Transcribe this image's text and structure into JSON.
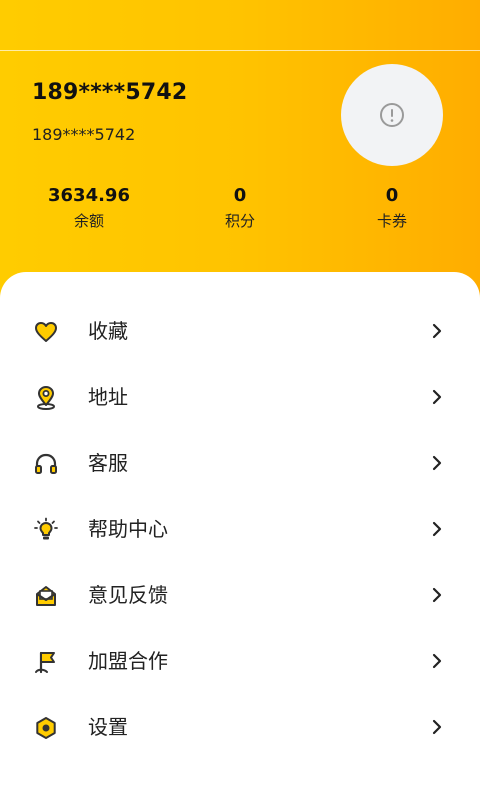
{
  "profile": {
    "title": "189****5742",
    "subtitle": "189****5742",
    "avatar_icon": "alert-circle-icon"
  },
  "stats": [
    {
      "value": "3634.96",
      "label": "余额"
    },
    {
      "value": "0",
      "label": "积分"
    },
    {
      "value": "0",
      "label": "卡券"
    }
  ],
  "menu": [
    {
      "label": "收藏",
      "icon": "heart-icon"
    },
    {
      "label": "地址",
      "icon": "location-pin-icon"
    },
    {
      "label": "客服",
      "icon": "headphones-icon"
    },
    {
      "label": "帮助中心",
      "icon": "lightbulb-icon"
    },
    {
      "label": "意见反馈",
      "icon": "mail-icon"
    },
    {
      "label": "加盟合作",
      "icon": "flag-icon"
    },
    {
      "label": "设置",
      "icon": "settings-icon"
    }
  ],
  "colors": {
    "accent": "#ffc300",
    "icon_fill": "#ffcc00",
    "icon_stroke": "#333333"
  }
}
